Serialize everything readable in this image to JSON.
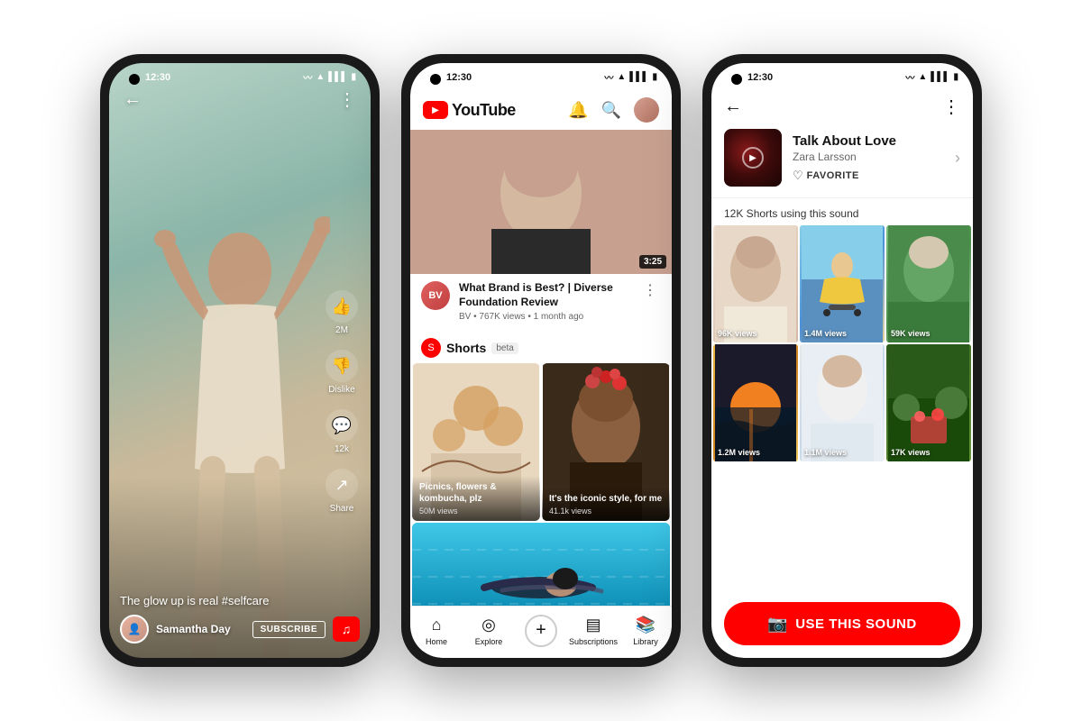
{
  "phone1": {
    "status_time": "12:30",
    "caption": "The glow up is real #selfcare",
    "user_name": "Samantha Day",
    "subscribe_label": "SUBSCRIBE",
    "like_count": "2M",
    "dislike_label": "Dislike",
    "comment_count": "12k",
    "share_label": "Share",
    "bg_gradient": "linear-gradient(160deg, #b8d4c8 0%, #8ab5a8 30%, #c9b99a 60%, #d4c5a5 100%)"
  },
  "phone2": {
    "status_time": "12:30",
    "logo_text": "YouTube",
    "video": {
      "title": "What Brand is Best? | Diverse Foundation Review",
      "channel": "BV",
      "meta": "767K views • 1 month ago",
      "duration": "3:25"
    },
    "shorts": {
      "label": "Shorts",
      "badge": "beta",
      "items": [
        {
          "title": "Picnics, flowers & kombucha, plz",
          "views": "50M views"
        },
        {
          "title": "It's the iconic style, for me",
          "views": "41.1k views"
        }
      ]
    },
    "nav": {
      "home": "Home",
      "explore": "Explore",
      "subscriptions": "Subscriptions",
      "library": "Library"
    }
  },
  "phone3": {
    "status_time": "12:30",
    "song_title": "Talk About Love",
    "song_artist": "Zara Larsson",
    "fav_label": "FAVORITE",
    "shorts_count": "12K Shorts using this sound",
    "use_sound_label": "USE THIS SOUND",
    "videos": [
      {
        "views": "96K views"
      },
      {
        "views": "1.4M views"
      },
      {
        "views": "59K views"
      },
      {
        "views": "1.2M views"
      },
      {
        "views": "1.1M views"
      },
      {
        "views": "17K views"
      }
    ]
  },
  "icons": {
    "back": "←",
    "more": "⋮",
    "bell": "🔔",
    "search": "🔍",
    "home": "⌂",
    "explore": "◎",
    "plus": "+",
    "subscriptions": "▤",
    "library": "📚",
    "like": "👍",
    "dislike": "👎",
    "comment": "💬",
    "share": "↗",
    "camera": "📷",
    "music": "♪",
    "play": "▶",
    "heart": "♡"
  }
}
